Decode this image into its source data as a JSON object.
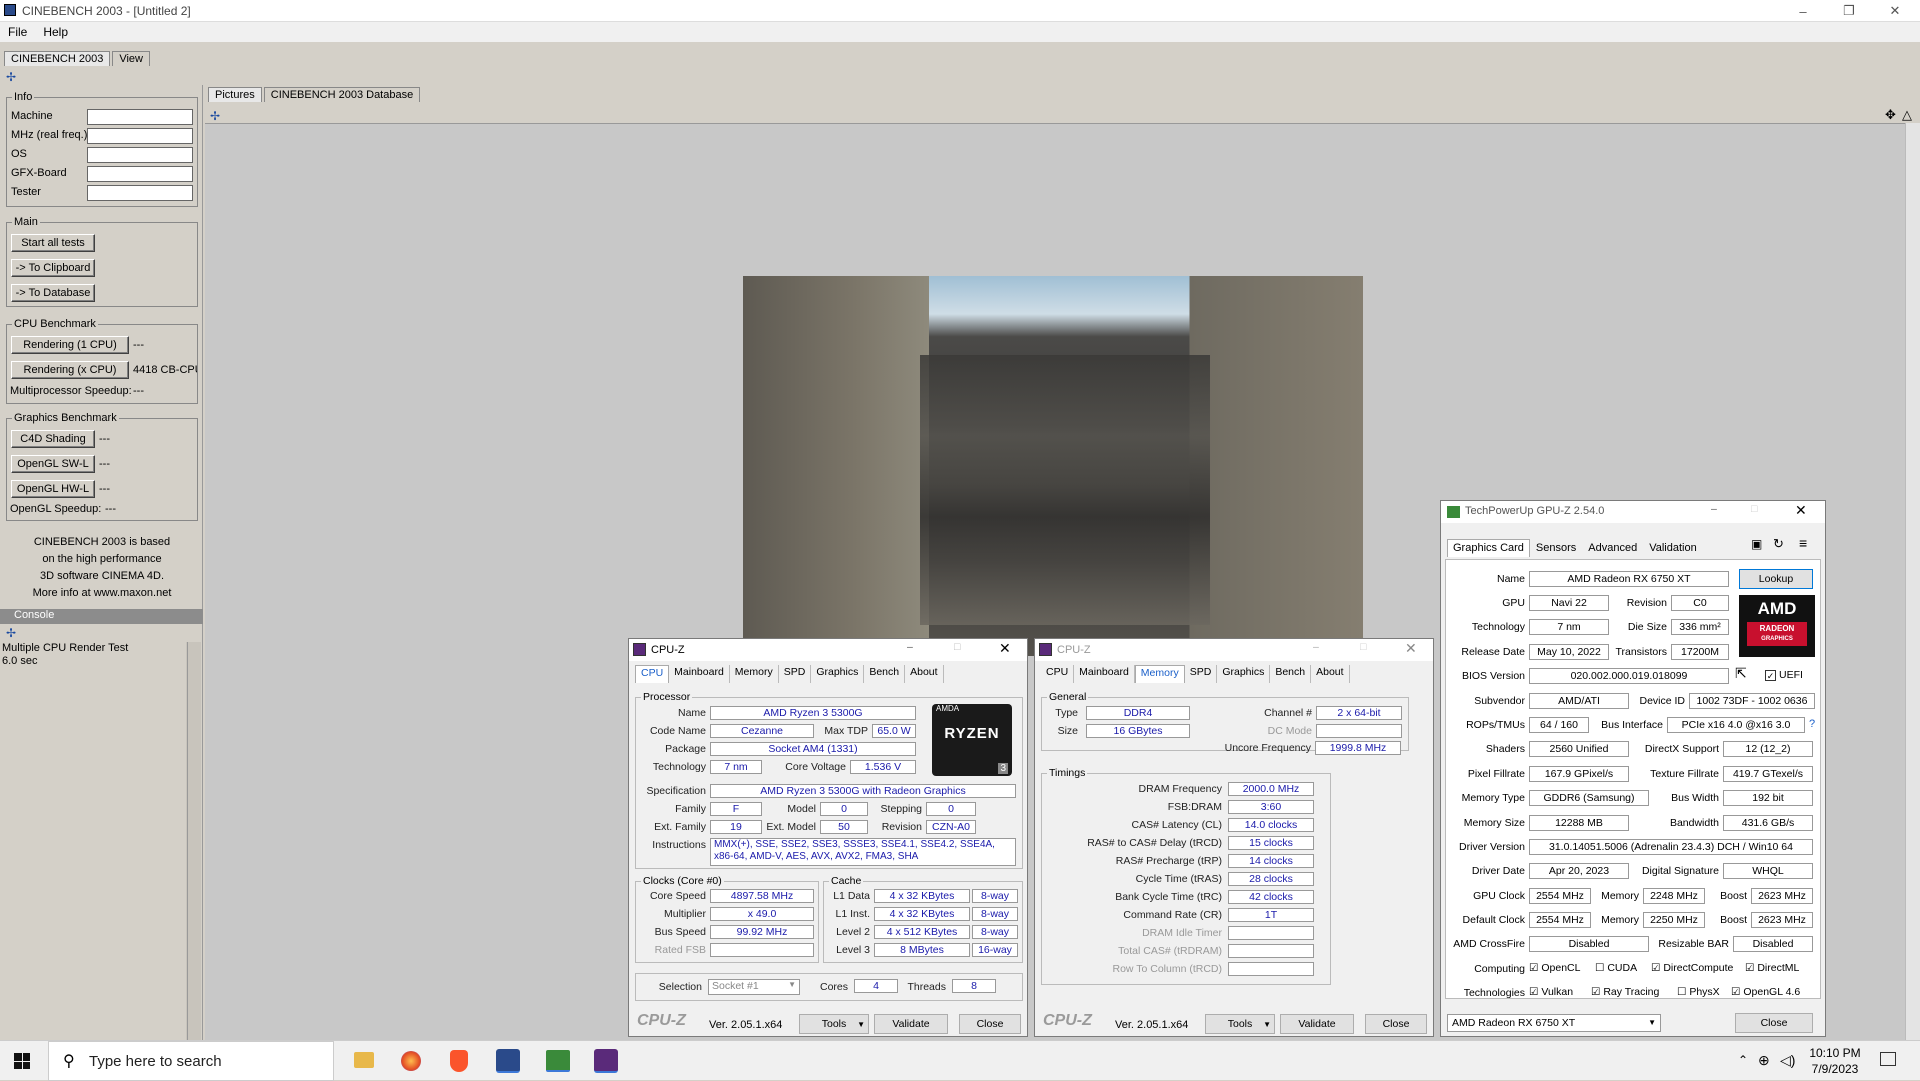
{
  "window": {
    "title": "CINEBENCH 2003 - [Untitled 2]",
    "minimize": "–",
    "restore": "❐",
    "close": "✕"
  },
  "menu": [
    "File",
    "Help"
  ],
  "top_tabs": [
    "CINEBENCH 2003",
    "View"
  ],
  "info": {
    "title": "Info",
    "fields": [
      "Machine",
      "MHz (real freq.)",
      "OS",
      "GFX-Board",
      "Tester"
    ]
  },
  "main": {
    "title": "Main",
    "buttons": [
      "Start all tests",
      "-> To Clipboard",
      "-> To Database"
    ]
  },
  "cpu_bench": {
    "title": "CPU Benchmark",
    "btn1": "Rendering (1 CPU)",
    "res1": "---",
    "btn2": "Rendering (x CPU)",
    "res2": "4418 CB-CPU",
    "speedup_label": "Multiprocessor Speedup:",
    "speedup": "---"
  },
  "gfx_bench": {
    "title": "Graphics Benchmark",
    "btn1": "C4D Shading",
    "res1": "---",
    "btn2": "OpenGL SW-L",
    "res2": "---",
    "btn3": "OpenGL HW-L",
    "res3": "---",
    "speedup_label": "OpenGL Speedup:",
    "speedup": "---"
  },
  "about_text": [
    "CINEBENCH 2003 is based",
    "on the high performance",
    "3D software CINEMA 4D.",
    "More info at www.maxon.net"
  ],
  "console": {
    "title": "Console",
    "line1": "Multiple CPU Render Test",
    "line2": "6.0 sec"
  },
  "view_tabs": [
    "Pictures",
    "CINEBENCH 2003 Database"
  ],
  "cpuz1": {
    "title": "CPU-Z",
    "tabs": [
      "CPU",
      "Mainboard",
      "Memory",
      "SPD",
      "Graphics",
      "Bench",
      "About"
    ],
    "processor_label": "Processor",
    "name_l": "Name",
    "name": "AMD Ryzen 3 5300G",
    "code_l": "Code Name",
    "code": "Cezanne",
    "tdp_l": "Max TDP",
    "tdp": "65.0 W",
    "pkg_l": "Package",
    "pkg": "Socket AM4 (1331)",
    "tech_l": "Technology",
    "tech": "7 nm",
    "cv_l": "Core Voltage",
    "cv": "1.536 V",
    "spec_l": "Specification",
    "spec": "AMD Ryzen 3 5300G with Radeon Graphics",
    "fam_l": "Family",
    "fam": "F",
    "model_l": "Model",
    "model": "0",
    "step_l": "Stepping",
    "step": "0",
    "efam_l": "Ext. Family",
    "efam": "19",
    "emod_l": "Ext. Model",
    "emod": "50",
    "rev_l": "Revision",
    "rev": "CZN-A0",
    "instr_l": "Instructions",
    "instr1": "MMX(+), SSE, SSE2, SSE3, SSSE3, SSE4.1, SSE4.2, SSE4A,",
    "instr2": "x86-64, AMD-V, AES, AVX, AVX2, FMA3, SHA",
    "clocks_label": "Clocks (Core #0)",
    "cs_l": "Core Speed",
    "cs": "4897.58 MHz",
    "mul_l": "Multiplier",
    "mul": "x 49.0",
    "bus_l": "Bus Speed",
    "bus": "99.92 MHz",
    "fsb_l": "Rated FSB",
    "fsb": "",
    "cache_label": "Cache",
    "l1d_l": "L1 Data",
    "l1d": "4 x 32 KBytes",
    "l1d_w": "8-way",
    "l1i_l": "L1 Inst.",
    "l1i": "4 x 32 KBytes",
    "l1i_w": "8-way",
    "l2_l": "Level 2",
    "l2": "4 x 512 KBytes",
    "l2_w": "8-way",
    "l3_l": "Level 3",
    "l3": "8 MBytes",
    "l3_w": "16-way",
    "sel_l": "Selection",
    "sel": "Socket #1",
    "cores_l": "Cores",
    "cores": "4",
    "threads_l": "Threads",
    "threads": "8",
    "brand": "CPU-Z",
    "ver": "Ver. 2.05.1.x64",
    "tools": "Tools",
    "validate": "Validate",
    "close": "Close",
    "logo_top": "AMDA",
    "logo_mid": "RYZEN",
    "logo_num": "3"
  },
  "cpuz2": {
    "title": "CPU-Z",
    "tabs": [
      "CPU",
      "Mainboard",
      "Memory",
      "SPD",
      "Graphics",
      "Bench",
      "About"
    ],
    "general_label": "General",
    "type_l": "Type",
    "type": "DDR4",
    "ch_l": "Channel #",
    "ch": "2 x 64-bit",
    "size_l": "Size",
    "size": "16 GBytes",
    "dc_l": "DC Mode",
    "dc": "",
    "unc_l": "Uncore Frequency",
    "unc": "1999.8 MHz",
    "timings_label": "Timings",
    "timings": [
      {
        "l": "DRAM Frequency",
        "v": "2000.0 MHz"
      },
      {
        "l": "FSB:DRAM",
        "v": "3:60"
      },
      {
        "l": "CAS# Latency (CL)",
        "v": "14.0 clocks"
      },
      {
        "l": "RAS# to CAS# Delay (tRCD)",
        "v": "15 clocks"
      },
      {
        "l": "RAS# Precharge (tRP)",
        "v": "14 clocks"
      },
      {
        "l": "Cycle Time (tRAS)",
        "v": "28 clocks"
      },
      {
        "l": "Bank Cycle Time (tRC)",
        "v": "42 clocks"
      },
      {
        "l": "Command Rate (CR)",
        "v": "1T"
      },
      {
        "l": "DRAM Idle Timer",
        "v": ""
      },
      {
        "l": "Total CAS# (tRDRAM)",
        "v": ""
      },
      {
        "l": "Row To Column (tRCD)",
        "v": ""
      }
    ],
    "brand": "CPU-Z",
    "ver": "Ver. 2.05.1.x64",
    "tools": "Tools",
    "validate": "Validate",
    "close": "Close"
  },
  "gpuz": {
    "title": "TechPowerUp GPU-Z 2.54.0",
    "tabs": [
      "Graphics Card",
      "Sensors",
      "Advanced",
      "Validation"
    ],
    "name_l": "Name",
    "name": "AMD Radeon RX 6750 XT",
    "lookup": "Lookup",
    "gpu_l": "GPU",
    "gpu": "Navi 22",
    "rev_l": "Revision",
    "rev": "C0",
    "tech_l": "Technology",
    "tech": "7 nm",
    "die_l": "Die Size",
    "die": "336 mm²",
    "rel_l": "Release Date",
    "rel": "May 10, 2022",
    "trans_l": "Transistors",
    "trans": "17200M",
    "bios_l": "BIOS Version",
    "bios": "020.002.000.019.018099",
    "uefi": "UEFI",
    "sub_l": "Subvendor",
    "sub": "AMD/ATI",
    "dev_l": "Device ID",
    "dev": "1002 73DF - 1002 0636",
    "rops_l": "ROPs/TMUs",
    "rops": "64 / 160",
    "bus_l": "Bus Interface",
    "bus": "PCIe x16 4.0 @x16 3.0",
    "q": "?",
    "sh_l": "Shaders",
    "sh": "2560 Unified",
    "dx_l": "DirectX Support",
    "dx": "12 (12_2)",
    "pf_l": "Pixel Fillrate",
    "pf": "167.9 GPixel/s",
    "tf_l": "Texture Fillrate",
    "tf": "419.7 GTexel/s",
    "mt_l": "Memory Type",
    "mt": "GDDR6 (Samsung)",
    "bw_l": "Bus Width",
    "bw": "192 bit",
    "ms_l": "Memory Size",
    "ms": "12288 MB",
    "band_l": "Bandwidth",
    "band": "431.6 GB/s",
    "drv_l": "Driver Version",
    "drv": "31.0.14051.5006 (Adrenalin 23.4.3) DCH / Win10 64",
    "dd_l": "Driver Date",
    "dd": "Apr 20, 2023",
    "sig_l": "Digital Signature",
    "sig": "WHQL",
    "gc_l": "GPU Clock",
    "gc": "2554 MHz",
    "mem_l": "Memory",
    "gmem": "2248 MHz",
    "boost_l": "Boost",
    "gboost": "2623 MHz",
    "dc_l": "Default Clock",
    "dc": "2554 MHz",
    "dmem": "2250 MHz",
    "dboost": "2623 MHz",
    "cf_l": "AMD CrossFire",
    "cf": "Disabled",
    "rb_l": "Resizable BAR",
    "rb": "Disabled",
    "comp_l": "Computing",
    "comp": [
      "OpenCL",
      "CUDA",
      "DirectCompute",
      "DirectML"
    ],
    "comp_chk": [
      true,
      false,
      true,
      true
    ],
    "techs_l": "Technologies",
    "techs": [
      "Vulkan",
      "Ray Tracing",
      "PhysX",
      "OpenGL 4.6"
    ],
    "techs_chk": [
      true,
      true,
      false,
      true
    ],
    "select": "AMD Radeon RX 6750 XT",
    "close": "Close",
    "logo_top": "AMD",
    "logo_sub1": "RADEON",
    "logo_sub2": "GRAPHICS"
  },
  "taskbar": {
    "search": "Type here to search",
    "time": "10:10 PM",
    "date": "7/9/2023"
  }
}
